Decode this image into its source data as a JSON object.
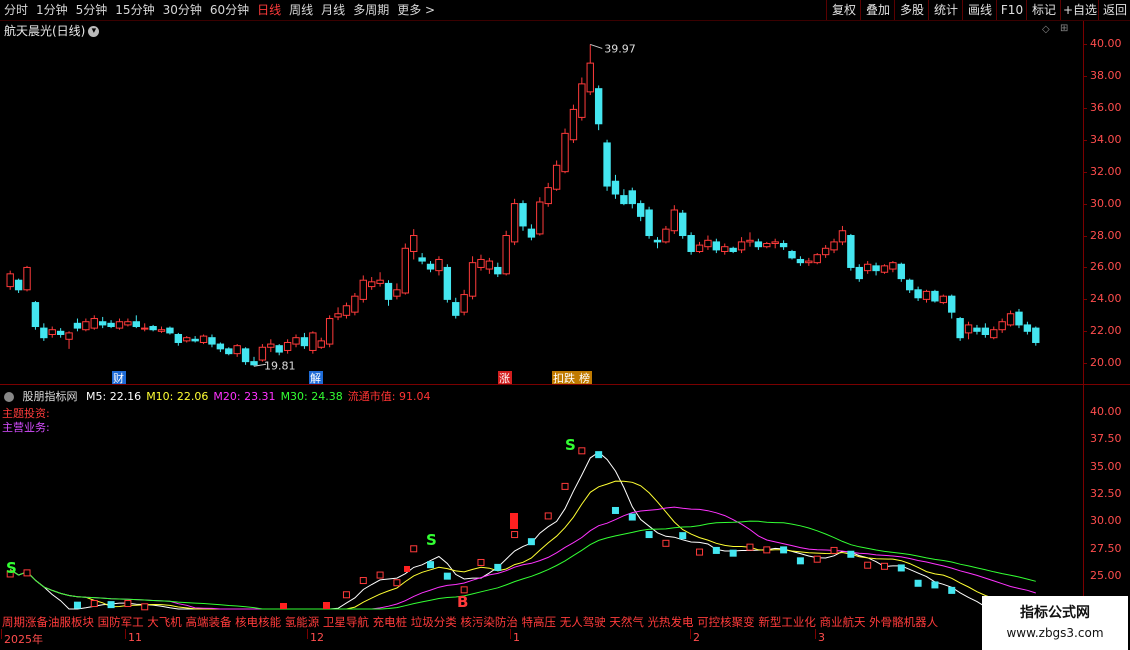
{
  "toolbar": {
    "timeframes": [
      "分时",
      "1分钟",
      "5分钟",
      "15分钟",
      "30分钟",
      "60分钟",
      "日线",
      "周线",
      "月线",
      "多周期",
      "更多 >"
    ],
    "active_timeframe": "日线",
    "right_buttons": [
      "复权",
      "叠加",
      "多股",
      "统计",
      "画线",
      "F10",
      "标记",
      "+自选",
      "返回"
    ]
  },
  "stock": {
    "title": "航天晨光(日线)"
  },
  "price_axis": [
    "40.00",
    "38.00",
    "36.00",
    "34.00",
    "32.00",
    "30.00",
    "28.00",
    "26.00",
    "24.00",
    "22.00",
    "20.00"
  ],
  "high_marker": "39.97",
  "low_marker": "19.81",
  "event_tags": [
    {
      "label": "财",
      "color": "#1e6bd6"
    },
    {
      "label": "解",
      "color": "#1e6bd6"
    },
    {
      "label": "涨",
      "color": "#d21f1f"
    },
    {
      "label": "扣跌",
      "color": "#c07a00"
    },
    {
      "label": "榜",
      "color": "#c07a00"
    }
  ],
  "indicator": {
    "name": "股朋指标网",
    "params": [
      {
        "text": "M5: 22.16",
        "color": "#ffffff"
      },
      {
        "text": "M10: 22.06",
        "color": "#ffff33"
      },
      {
        "text": "M20: 23.31",
        "color": "#ff33ff"
      },
      {
        "text": "M30: 24.38",
        "color": "#33ff33"
      },
      {
        "text": "流通市值: 91.04",
        "color": "#ff3333"
      }
    ],
    "theme_label": "主题投资:",
    "business_label": "主营业务:",
    "axis": [
      "40.00",
      "37.50",
      "35.00",
      "32.50",
      "30.00",
      "27.50",
      "25.00",
      "22.50"
    ],
    "signals": [
      "S",
      "S",
      "B",
      "S"
    ]
  },
  "concepts": "周期涨备油服板块 国防军工 大飞机 高端装备 核电核能 氢能源 卫星导航 充电桩 垃圾分类 核污染防治 特高压 无人驾驶 天然气 光热发电 可控核聚变 新型工业化 商业航天 外骨骼机器人",
  "date_axis": [
    "2025年",
    "11",
    "12",
    "1",
    "2",
    "3"
  ],
  "watermark": {
    "line1": "指标公式网",
    "line2": "www.zbgs3.com"
  },
  "chart_data": {
    "type": "candlestick",
    "title": "航天晨光(日线)",
    "ylim": [
      19.2,
      41.0
    ],
    "high": 39.97,
    "low": 19.81,
    "candles": [
      {
        "o": 24.8,
        "c": 25.6,
        "h": 25.8,
        "l": 24.6
      },
      {
        "o": 25.2,
        "c": 24.6,
        "h": 25.3,
        "l": 24.4
      },
      {
        "o": 24.6,
        "c": 26.0,
        "h": 26.1,
        "l": 24.5
      },
      {
        "o": 23.8,
        "c": 22.3,
        "h": 23.9,
        "l": 22.1
      },
      {
        "o": 22.2,
        "c": 21.6,
        "h": 22.5,
        "l": 21.4
      },
      {
        "o": 21.8,
        "c": 22.1,
        "h": 22.3,
        "l": 21.6
      },
      {
        "o": 22.0,
        "c": 21.8,
        "h": 22.2,
        "l": 21.6
      },
      {
        "o": 21.5,
        "c": 21.9,
        "h": 22.0,
        "l": 20.9
      },
      {
        "o": 22.5,
        "c": 22.2,
        "h": 22.8,
        "l": 22.0
      },
      {
        "o": 22.1,
        "c": 22.6,
        "h": 22.8,
        "l": 22.0
      },
      {
        "o": 22.2,
        "c": 22.8,
        "h": 23.0,
        "l": 22.1
      },
      {
        "o": 22.6,
        "c": 22.4,
        "h": 22.9,
        "l": 22.2
      },
      {
        "o": 22.5,
        "c": 22.3,
        "h": 22.7,
        "l": 22.2
      },
      {
        "o": 22.2,
        "c": 22.6,
        "h": 22.8,
        "l": 22.1
      },
      {
        "o": 22.4,
        "c": 22.6,
        "h": 22.8,
        "l": 22.3
      },
      {
        "o": 22.6,
        "c": 22.3,
        "h": 23.0,
        "l": 22.2
      },
      {
        "o": 22.2,
        "c": 22.2,
        "h": 22.5,
        "l": 22.0
      },
      {
        "o": 22.3,
        "c": 22.1,
        "h": 22.4,
        "l": 22.0
      },
      {
        "o": 22.0,
        "c": 22.1,
        "h": 22.3,
        "l": 21.9
      },
      {
        "o": 22.2,
        "c": 21.9,
        "h": 22.3,
        "l": 21.8
      },
      {
        "o": 21.8,
        "c": 21.3,
        "h": 21.9,
        "l": 21.1
      },
      {
        "o": 21.4,
        "c": 21.6,
        "h": 21.7,
        "l": 21.3
      },
      {
        "o": 21.5,
        "c": 21.4,
        "h": 21.7,
        "l": 21.3
      },
      {
        "o": 21.3,
        "c": 21.7,
        "h": 21.8,
        "l": 21.2
      },
      {
        "o": 21.6,
        "c": 21.2,
        "h": 21.8,
        "l": 21.0
      },
      {
        "o": 21.2,
        "c": 20.9,
        "h": 21.3,
        "l": 20.7
      },
      {
        "o": 20.9,
        "c": 20.6,
        "h": 21.0,
        "l": 20.5
      },
      {
        "o": 20.6,
        "c": 21.1,
        "h": 21.2,
        "l": 20.4
      },
      {
        "o": 20.9,
        "c": 20.1,
        "h": 21.0,
        "l": 19.9
      },
      {
        "o": 20.1,
        "c": 19.9,
        "h": 20.4,
        "l": 19.81
      },
      {
        "o": 20.2,
        "c": 21.0,
        "h": 21.2,
        "l": 20.1
      },
      {
        "o": 21.0,
        "c": 21.2,
        "h": 21.5,
        "l": 20.7
      },
      {
        "o": 21.1,
        "c": 20.7,
        "h": 21.2,
        "l": 20.5
      },
      {
        "o": 20.8,
        "c": 21.3,
        "h": 21.5,
        "l": 20.6
      },
      {
        "o": 21.2,
        "c": 21.6,
        "h": 21.8,
        "l": 21.0
      },
      {
        "o": 21.6,
        "c": 21.1,
        "h": 21.9,
        "l": 20.9
      },
      {
        "o": 20.8,
        "c": 21.9,
        "h": 22.0,
        "l": 20.6
      },
      {
        "o": 21.0,
        "c": 21.4,
        "h": 21.6,
        "l": 20.9
      },
      {
        "o": 21.2,
        "c": 22.8,
        "h": 23.0,
        "l": 21.0
      },
      {
        "o": 22.9,
        "c": 23.1,
        "h": 23.5,
        "l": 22.7
      },
      {
        "o": 23.0,
        "c": 23.6,
        "h": 23.8,
        "l": 22.8
      },
      {
        "o": 23.2,
        "c": 24.2,
        "h": 24.4,
        "l": 23.0
      },
      {
        "o": 24.0,
        "c": 25.2,
        "h": 25.5,
        "l": 23.8
      },
      {
        "o": 24.8,
        "c": 25.1,
        "h": 25.4,
        "l": 24.6
      },
      {
        "o": 25.0,
        "c": 25.2,
        "h": 25.7,
        "l": 24.8
      },
      {
        "o": 25.0,
        "c": 24.0,
        "h": 25.2,
        "l": 23.6
      },
      {
        "o": 24.2,
        "c": 24.6,
        "h": 25.0,
        "l": 24.0
      },
      {
        "o": 24.4,
        "c": 27.2,
        "h": 27.5,
        "l": 24.3
      },
      {
        "o": 27.0,
        "c": 28.0,
        "h": 28.4,
        "l": 26.5
      },
      {
        "o": 26.6,
        "c": 26.4,
        "h": 26.9,
        "l": 26.2
      },
      {
        "o": 26.2,
        "c": 25.9,
        "h": 26.4,
        "l": 25.7
      },
      {
        "o": 25.8,
        "c": 26.5,
        "h": 26.7,
        "l": 25.5
      },
      {
        "o": 26.0,
        "c": 24.0,
        "h": 26.2,
        "l": 23.8
      },
      {
        "o": 23.8,
        "c": 23.0,
        "h": 24.1,
        "l": 22.8
      },
      {
        "o": 23.2,
        "c": 24.3,
        "h": 24.6,
        "l": 23.0
      },
      {
        "o": 24.2,
        "c": 26.3,
        "h": 26.7,
        "l": 24.0
      },
      {
        "o": 26.0,
        "c": 26.5,
        "h": 26.8,
        "l": 25.8
      },
      {
        "o": 25.9,
        "c": 26.4,
        "h": 26.6,
        "l": 25.6
      },
      {
        "o": 26.0,
        "c": 25.6,
        "h": 26.3,
        "l": 25.4
      },
      {
        "o": 25.6,
        "c": 28.0,
        "h": 28.3,
        "l": 25.5
      },
      {
        "o": 27.6,
        "c": 30.0,
        "h": 30.3,
        "l": 27.4
      },
      {
        "o": 30.0,
        "c": 28.6,
        "h": 30.2,
        "l": 28.3
      },
      {
        "o": 28.4,
        "c": 27.9,
        "h": 28.7,
        "l": 27.7
      },
      {
        "o": 28.1,
        "c": 30.1,
        "h": 30.4,
        "l": 28.0
      },
      {
        "o": 30.0,
        "c": 31.0,
        "h": 31.3,
        "l": 29.8
      },
      {
        "o": 30.9,
        "c": 32.4,
        "h": 32.7,
        "l": 30.8
      },
      {
        "o": 32.0,
        "c": 34.4,
        "h": 34.7,
        "l": 31.9
      },
      {
        "o": 34.0,
        "c": 35.9,
        "h": 36.2,
        "l": 33.8
      },
      {
        "o": 35.4,
        "c": 37.5,
        "h": 37.9,
        "l": 35.2
      },
      {
        "o": 37.0,
        "c": 38.8,
        "h": 39.97,
        "l": 36.8
      },
      {
        "o": 37.2,
        "c": 35.0,
        "h": 37.4,
        "l": 34.6
      },
      {
        "o": 33.8,
        "c": 31.1,
        "h": 34.0,
        "l": 30.8
      },
      {
        "o": 31.4,
        "c": 30.6,
        "h": 31.8,
        "l": 30.3
      },
      {
        "o": 30.5,
        "c": 30.0,
        "h": 30.9,
        "l": 29.9
      },
      {
        "o": 30.8,
        "c": 30.0,
        "h": 31.0,
        "l": 29.7
      },
      {
        "o": 30.0,
        "c": 29.2,
        "h": 30.2,
        "l": 28.9
      },
      {
        "o": 29.6,
        "c": 28.0,
        "h": 29.8,
        "l": 27.8
      },
      {
        "o": 27.7,
        "c": 27.6,
        "h": 27.9,
        "l": 27.2
      },
      {
        "o": 27.6,
        "c": 28.4,
        "h": 28.6,
        "l": 27.5
      },
      {
        "o": 28.3,
        "c": 29.6,
        "h": 29.9,
        "l": 28.1
      },
      {
        "o": 29.4,
        "c": 28.0,
        "h": 29.6,
        "l": 27.8
      },
      {
        "o": 28.0,
        "c": 27.0,
        "h": 28.2,
        "l": 26.8
      },
      {
        "o": 27.0,
        "c": 27.4,
        "h": 27.6,
        "l": 26.9
      },
      {
        "o": 27.3,
        "c": 27.7,
        "h": 28.0,
        "l": 27.1
      },
      {
        "o": 27.6,
        "c": 27.1,
        "h": 27.8,
        "l": 26.9
      },
      {
        "o": 27.0,
        "c": 27.3,
        "h": 27.5,
        "l": 26.8
      },
      {
        "o": 27.2,
        "c": 27.0,
        "h": 27.3,
        "l": 26.9
      },
      {
        "o": 27.1,
        "c": 27.6,
        "h": 27.9,
        "l": 26.9
      },
      {
        "o": 27.6,
        "c": 27.7,
        "h": 28.2,
        "l": 27.3
      },
      {
        "o": 27.6,
        "c": 27.3,
        "h": 27.8,
        "l": 27.1
      },
      {
        "o": 27.3,
        "c": 27.5,
        "h": 27.6,
        "l": 27.2
      },
      {
        "o": 27.5,
        "c": 27.6,
        "h": 27.8,
        "l": 27.2
      },
      {
        "o": 27.5,
        "c": 27.3,
        "h": 27.7,
        "l": 27.1
      },
      {
        "o": 27.0,
        "c": 26.6,
        "h": 27.1,
        "l": 26.5
      },
      {
        "o": 26.5,
        "c": 26.3,
        "h": 26.7,
        "l": 26.1
      },
      {
        "o": 26.3,
        "c": 26.4,
        "h": 26.6,
        "l": 26.1
      },
      {
        "o": 26.3,
        "c": 26.8,
        "h": 26.9,
        "l": 26.2
      },
      {
        "o": 26.8,
        "c": 27.2,
        "h": 27.4,
        "l": 26.6
      },
      {
        "o": 27.1,
        "c": 27.6,
        "h": 27.8,
        "l": 26.9
      },
      {
        "o": 27.6,
        "c": 28.3,
        "h": 28.6,
        "l": 27.4
      },
      {
        "o": 28.0,
        "c": 26.0,
        "h": 28.1,
        "l": 25.8
      },
      {
        "o": 26.0,
        "c": 25.3,
        "h": 26.2,
        "l": 25.1
      },
      {
        "o": 25.8,
        "c": 26.2,
        "h": 26.4,
        "l": 25.6
      },
      {
        "o": 26.1,
        "c": 25.8,
        "h": 26.3,
        "l": 25.5
      },
      {
        "o": 25.7,
        "c": 26.1,
        "h": 26.2,
        "l": 25.6
      },
      {
        "o": 25.9,
        "c": 26.3,
        "h": 26.4,
        "l": 25.7
      },
      {
        "o": 26.2,
        "c": 25.3,
        "h": 26.3,
        "l": 25.1
      },
      {
        "o": 25.2,
        "c": 24.6,
        "h": 25.3,
        "l": 24.4
      },
      {
        "o": 24.6,
        "c": 24.1,
        "h": 24.8,
        "l": 23.9
      },
      {
        "o": 24.0,
        "c": 24.5,
        "h": 24.6,
        "l": 23.8
      },
      {
        "o": 24.5,
        "c": 23.9,
        "h": 24.6,
        "l": 23.8
      },
      {
        "o": 23.8,
        "c": 24.2,
        "h": 24.3,
        "l": 23.7
      },
      {
        "o": 24.2,
        "c": 23.2,
        "h": 24.3,
        "l": 22.8
      },
      {
        "o": 22.8,
        "c": 21.6,
        "h": 22.9,
        "l": 21.4
      },
      {
        "o": 21.9,
        "c": 22.4,
        "h": 22.6,
        "l": 21.5
      },
      {
        "o": 22.2,
        "c": 22.0,
        "h": 22.4,
        "l": 21.8
      },
      {
        "o": 22.2,
        "c": 21.8,
        "h": 22.5,
        "l": 21.6
      },
      {
        "o": 21.6,
        "c": 22.1,
        "h": 22.3,
        "l": 21.5
      },
      {
        "o": 22.1,
        "c": 22.6,
        "h": 22.8,
        "l": 21.9
      },
      {
        "o": 22.4,
        "c": 23.1,
        "h": 23.3,
        "l": 22.3
      },
      {
        "o": 23.2,
        "c": 22.4,
        "h": 23.4,
        "l": 22.2
      },
      {
        "o": 22.4,
        "c": 22.0,
        "h": 22.6,
        "l": 21.8
      },
      {
        "o": 22.2,
        "c": 21.3,
        "h": 22.3,
        "l": 21.1
      }
    ]
  }
}
